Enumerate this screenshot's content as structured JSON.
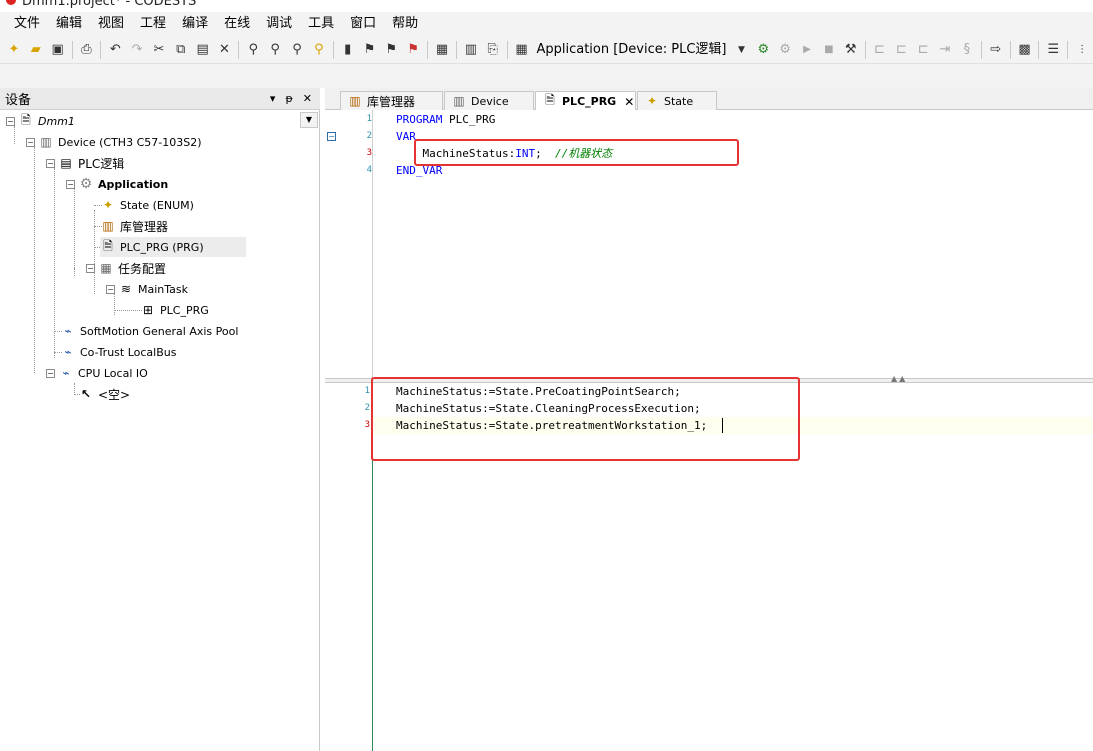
{
  "window": {
    "title": "Dmm1.project* - CODESYS"
  },
  "menu": [
    "文件",
    "编辑",
    "视图",
    "工程",
    "编译",
    "在线",
    "调试",
    "工具",
    "窗口",
    "帮助"
  ],
  "toolbar": {
    "app_selector": "Application [Device: PLC逻辑]"
  },
  "devices_panel": {
    "title": "设备",
    "controls": [
      "▾",
      "ᵽ",
      "✕"
    ],
    "tree": {
      "root": "Dmm1",
      "device": "Device (CTH3 C57-103S2)",
      "plc_logic": "PLC逻辑",
      "application": "Application",
      "state": "State (ENUM)",
      "library_manager": "库管理器",
      "plc_prg": "PLC_PRG (PRG)",
      "task_config": "任务配置",
      "main_task": "MainTask",
      "main_task_prg": "PLC_PRG",
      "softmotion": "SoftMotion General Axis Pool",
      "cotrust": "Co-Trust LocalBus",
      "cpu_io": "CPU Local IO",
      "empty": "<空>"
    }
  },
  "tabs": [
    {
      "label": "库管理器"
    },
    {
      "label": "Device"
    },
    {
      "label": "PLC_PRG",
      "active": true,
      "close": "✕"
    },
    {
      "label": "State"
    }
  ],
  "decl": {
    "line_numbers": [
      "1",
      "2",
      "3",
      "4"
    ],
    "l1_kw": "PROGRAM",
    "l1_name": " PLC_PRG",
    "l2": "VAR",
    "l3_name": "    MachineStatus:",
    "l3_type": "INT",
    "l3_sep": ";  ",
    "l3_comment": "//机器状态",
    "l4": "END_VAR"
  },
  "impl": {
    "line_numbers": [
      "1",
      "2",
      "3"
    ],
    "lines": [
      "MachineStatus:=State.PreCoatingPointSearch;",
      "MachineStatus:=State.CleaningProcessExecution;",
      "MachineStatus:=State.pretreatmentWorkstation_1;"
    ]
  },
  "colors": {
    "highlight_box": "#e53232",
    "keyword": "#0000ff",
    "comment": "#008000",
    "line_number": "#2b91af"
  }
}
